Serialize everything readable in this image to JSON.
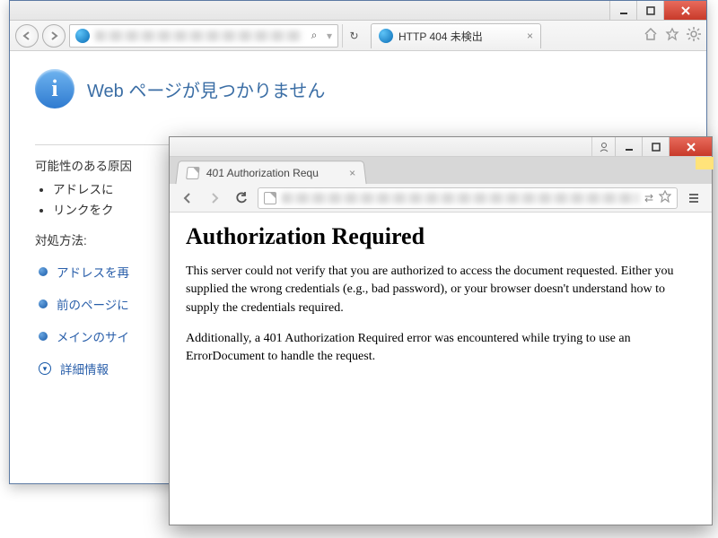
{
  "ie": {
    "tab_title": "HTTP 404 未検出",
    "heading": "Web ページが見つかりません",
    "http_code": "HTTP 404",
    "causes_label": "可能性のある原因",
    "causes": [
      "アドレスに",
      "リンクをク"
    ],
    "actions_label": "対処方法:",
    "actions": [
      "アドレスを再",
      "前のページに",
      "メインのサイ"
    ],
    "details_label": "詳細情報",
    "search_char": "⌕",
    "refresh_char": "↻"
  },
  "chrome": {
    "tab_title": "401 Authorization Requ",
    "heading": "Authorization Required",
    "para1": "This server could not verify that you are authorized to access the document requested. Either you supplied the wrong credentials (e.g., bad password), or your browser doesn't understand how to supply the credentials required.",
    "para2": "Additionally, a 401 Authorization Required error was encountered while trying to use an ErrorDocument to handle the request."
  }
}
